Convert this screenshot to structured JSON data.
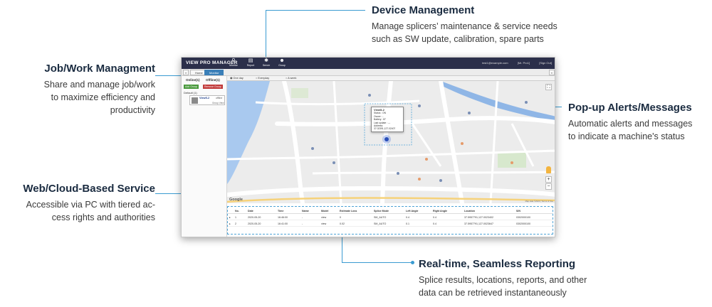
{
  "callouts": {
    "device": {
      "title": "Device Management",
      "line1": "Manage splicers’ maintenance &  service needs",
      "line2": "such as SW update, calibration, spare parts"
    },
    "job": {
      "title": "Job/Work Managment",
      "line1": "Share and manage job/work",
      "line2": "to maximize efficiency and",
      "line3": "productivity"
    },
    "popup": {
      "title": "Pop-up Alerts/Messages",
      "line1": "Automatic alerts and messages",
      "line2": "to indicate a machine's status"
    },
    "web": {
      "title": "Web/Cloud-Based Service",
      "line1": "Accessible via PC with tiered ac-",
      "line2": "cess rights and authorities"
    },
    "report": {
      "title": "Real-time, Seamless Reporting",
      "line1": "Splice results, locations, reports, and other",
      "line2": "data can be retrieved instantaneously"
    }
  },
  "colors": {
    "accent": "#3a9bd1",
    "topbar": "#2b2f4a",
    "water": "#a9c9ef"
  },
  "app": {
    "title": "VIEW PRO MANAGER",
    "nav": [
      {
        "icon": "map-pin-icon",
        "glyph": "⚲",
        "label": "Monitor"
      },
      {
        "icon": "report-icon",
        "glyph": "▤",
        "label": "Report"
      },
      {
        "icon": "gear-icon",
        "glyph": "✱",
        "label": "Server"
      },
      {
        "icon": "group-icon",
        "glyph": "☻",
        "label": "Group"
      }
    ],
    "user_email": "test1@example.com",
    "user_links": [
      "[Mr. Pro1]",
      "[Sign Out]"
    ],
    "tabs": [
      "Home",
      "Monitor"
    ],
    "online_label": "Online(1)",
    "offline_label": "Offline(1)",
    "btn_add_group": "Add Group",
    "btn_remove_group": "Remove Group",
    "default_group": "Default (1)",
    "device": {
      "name": "View5-2",
      "status": "offline",
      "group": "Group View"
    },
    "time_filters": [
      "One day",
      "Everyday",
      "A week"
    ],
    "popup": {
      "title": "View5-2",
      "status": "Status : ON",
      "owner": "Owner : -",
      "battery": "Battery : 87",
      "last_update": "Last update : ---",
      "address": "Address: 37.02391,127.02407"
    },
    "map_labels": {
      "google": "Google",
      "footer": "Map data ©2020 | Terms of Use",
      "zoom_in": "+",
      "zoom_out": "−"
    },
    "grid": {
      "headers": [
        "No.",
        "Date",
        "Time",
        "Name",
        "Model",
        "Estimate Loss",
        "Splice Mode",
        "Left Angle",
        "Right Angle",
        "Location",
        "S/N"
      ],
      "rows": [
        [
          "1",
          "2020-05-20",
          "16:46:00",
          "-",
          "view",
          "0",
          "SM_AUTO",
          "0.4",
          "0.4",
          "37.5957791,127.0023402",
          "0302000100"
        ],
        [
          "2",
          "2020-05-20",
          "16:41:00",
          "-",
          "view",
          "0.02",
          "SM_AUTO",
          "0.1",
          "0.4",
          "37.5957791,127.0023647",
          "0302000100"
        ]
      ]
    }
  }
}
